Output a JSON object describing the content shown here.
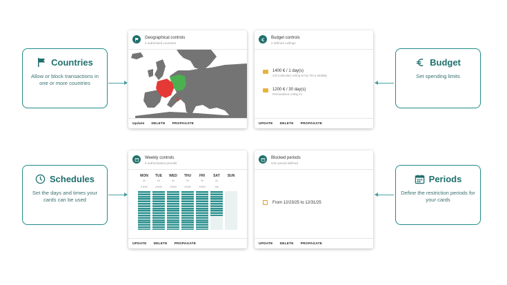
{
  "callouts": {
    "countries": {
      "title": "Countries",
      "desc": "Allow or block transactions in one or more countries",
      "icon": "flag-icon"
    },
    "budget": {
      "title": "Budget",
      "desc": "Set spending limits",
      "icon": "euro-icon"
    },
    "schedules": {
      "title": "Schedules",
      "desc": "Set the days and times your cards can be used",
      "icon": "clock-icon"
    },
    "periods": {
      "title": "Periods",
      "desc": "Define the restriction periods for your cards",
      "icon": "calendar-icon"
    }
  },
  "cards": {
    "geo": {
      "title": "Geographical controls",
      "subtitle": "4 authorised countries",
      "actions": [
        "Update",
        "DELETE",
        "PROPAGATE"
      ]
    },
    "budget": {
      "title": "Budget controls",
      "subtitle": "2 defined ceilings",
      "items": [
        {
          "value": "1400 € / 1 day(s)",
          "note": "24h (calendar) ceiling set by TEAL Mobility"
        },
        {
          "value": "1200 € / 30 day(s)",
          "note": "Personalized ceiling #1"
        }
      ],
      "actions": [
        "UPDATE",
        "DELETE",
        "PROPAGATE"
      ]
    },
    "weekly": {
      "title": "Weekly controls",
      "subtitle": "6 authorisation periods",
      "days": [
        {
          "label": "MON",
          "start": "0h",
          "end": "23h59"
        },
        {
          "label": "TUE",
          "start": "0h",
          "end": "23h59"
        },
        {
          "label": "WED",
          "start": "0h",
          "end": "23h59"
        },
        {
          "label": "THU",
          "start": "0h",
          "end": "23h59"
        },
        {
          "label": "FRI",
          "start": "0h",
          "end": "23h59"
        },
        {
          "label": "SAT",
          "start": "0h",
          "end": "16h"
        },
        {
          "label": "SUN",
          "start": "-",
          "end": ""
        }
      ],
      "actions": [
        "UPDATE",
        "DELETE",
        "PROPAGATE"
      ]
    },
    "blocked": {
      "title": "Blocked periods",
      "subtitle": "One period defined",
      "period": "From 12/23/25 to 12/31/25",
      "actions": [
        "UPDATE",
        "DELETE",
        "PROPAGATE"
      ]
    }
  },
  "colors": {
    "teal": "#1f6f6c",
    "green": "#4caf50",
    "red": "#e53935",
    "accent": "#e7b33a"
  }
}
